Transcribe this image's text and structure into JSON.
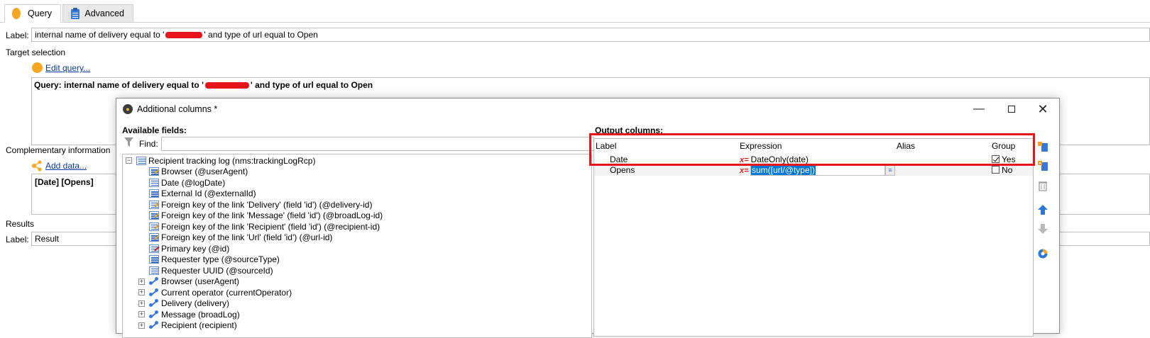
{
  "tabs": [
    {
      "label": "Query",
      "icon": "orange-dot-icon"
    },
    {
      "label": "Advanced",
      "icon": "clipboard-icon"
    }
  ],
  "form": {
    "label_caption": "Label:",
    "label_value_prefix": "internal name of delivery equal to '",
    "label_value_suffix": "' and type of url equal to Open",
    "target_selection_title": "Target selection",
    "edit_query_link": "Edit query...",
    "query_text_prefix": "Query: internal name of delivery equal to '",
    "query_text_suffix": "' and type of url equal to Open",
    "complementary_title": "Complementary information",
    "add_data_link": "Add data...",
    "complementary_value": "[Date]  [Opens]",
    "results_title": "Results",
    "results_label_caption": "Label:",
    "results_label_value": "Result"
  },
  "dialog": {
    "title": "Additional columns *",
    "available_fields_title": "Available fields:",
    "find_caption": "Find:",
    "find_value": "",
    "output_columns_title": "Output columns:",
    "tree": [
      {
        "label": "Recipient tracking log (nms:trackingLogRcp)",
        "kind": "root",
        "expander": "−"
      },
      {
        "label": "Browser (@userAgent)",
        "kind": "field-edit"
      },
      {
        "label": "Date (@logDate)",
        "kind": "field"
      },
      {
        "label": "External Id (@externalId)",
        "kind": "field"
      },
      {
        "label": "Foreign key of the link 'Delivery' (field 'id') (@delivery-id)",
        "kind": "field-edit"
      },
      {
        "label": "Foreign key of the link 'Message' (field 'id') (@broadLog-id)",
        "kind": "field-edit"
      },
      {
        "label": "Foreign key of the link 'Recipient' (field 'id') (@recipient-id)",
        "kind": "field-edit"
      },
      {
        "label": "Foreign key of the link 'Url' (field 'id') (@url-id)",
        "kind": "field-edit"
      },
      {
        "label": "Primary key (@id)",
        "kind": "field-key"
      },
      {
        "label": "Requester type (@sourceType)",
        "kind": "field"
      },
      {
        "label": "Requester UUID (@sourceId)",
        "kind": "field"
      },
      {
        "label": "Browser (userAgent)",
        "kind": "link",
        "expander": "+"
      },
      {
        "label": "Current operator (currentOperator)",
        "kind": "link",
        "expander": "+"
      },
      {
        "label": "Delivery (delivery)",
        "kind": "link",
        "expander": "+"
      },
      {
        "label": "Message (broadLog)",
        "kind": "link",
        "expander": "+"
      },
      {
        "label": "Recipient (recipient)",
        "kind": "link",
        "expander": "+"
      }
    ],
    "grid_headers": [
      "Label",
      "Expression",
      "Alias",
      "Group"
    ],
    "grid_rows": [
      {
        "label": "Date",
        "expression": "DateOnly(date)",
        "alias": "",
        "group": "Yes",
        "group_checked": true
      },
      {
        "label": "Opens",
        "expression": "sum([url/@type])",
        "alias": "",
        "group": "No",
        "group_checked": false
      }
    ],
    "expr_prefix": "x=",
    "side_icons": [
      "add-column-icon",
      "add-computed-column-icon",
      "delete-icon",
      "move-up-icon",
      "move-down-icon",
      "distribution-icon"
    ]
  },
  "colors": {
    "accent_orange": "#f5a623",
    "highlight_red": "#e8141c",
    "link_blue": "#0a3aa8",
    "selection_blue": "#0078d7"
  }
}
